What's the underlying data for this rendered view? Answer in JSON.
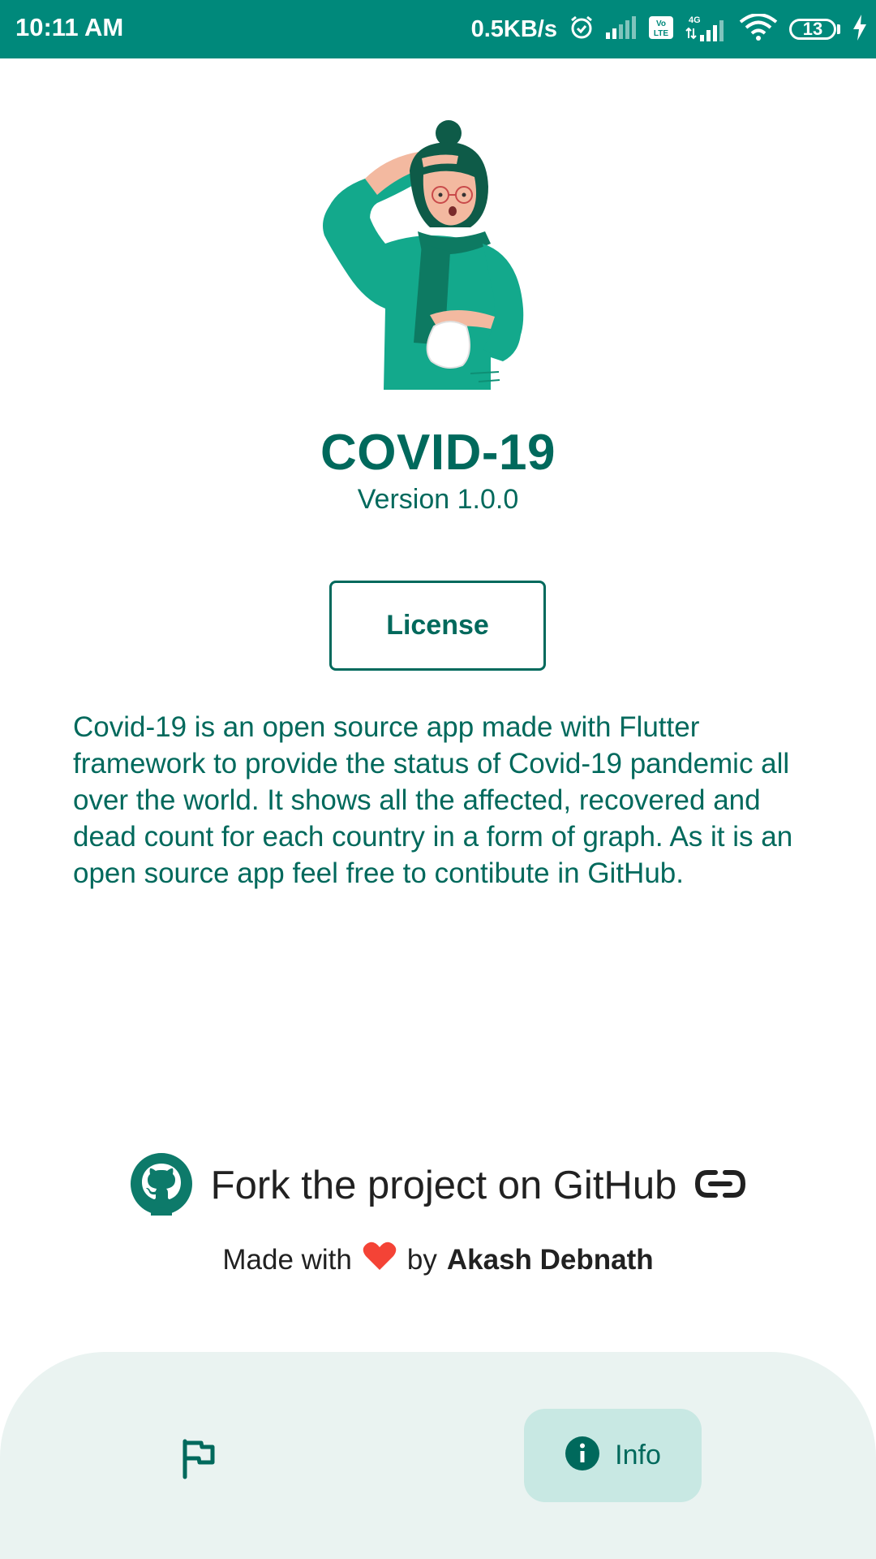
{
  "status_bar": {
    "time": "10:11 AM",
    "network_speed": "0.5KB/s",
    "battery_level": "13",
    "icons": [
      "alarm-icon",
      "signal-icon",
      "volte-icon",
      "4g-signal-icon",
      "wifi-icon",
      "battery-icon",
      "charging-icon"
    ]
  },
  "app": {
    "title": "COVID-19",
    "version": "Version 1.0.0",
    "license_button": "License",
    "description": "Covid-19 is an open source app made with Flutter framework to provide the status of Covid-19 pandemic all over the world. It shows all the affected, recovered and dead count for each country in a form of graph. As it is an open source app feel free to contibute in GitHub."
  },
  "github": {
    "text": "Fork the project on GitHub",
    "icon": "github-icon",
    "link_icon": "link-icon"
  },
  "credit": {
    "prefix": "Made with",
    "heart_icon": "heart-icon",
    "by": "by",
    "author": "Akash Debnath"
  },
  "bottom_nav": {
    "items": [
      {
        "icon": "flag-icon",
        "label": "",
        "active": false
      },
      {
        "icon": "info-icon",
        "label": "Info",
        "active": true
      }
    ]
  },
  "colors": {
    "primary": "#00897b",
    "text_teal": "#00695c",
    "nav_background": "#eaf3f1",
    "nav_active": "#c8e8e3",
    "heart": "#f44336"
  }
}
